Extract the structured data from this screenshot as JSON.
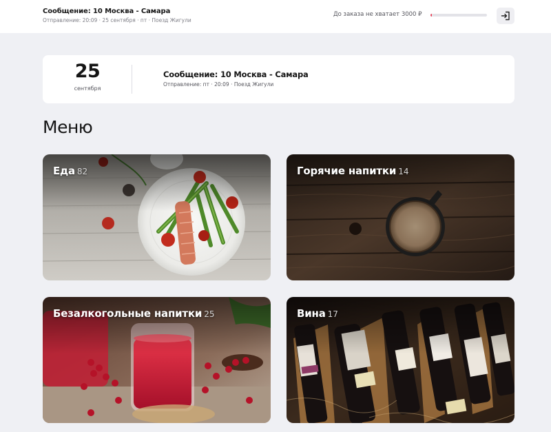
{
  "topbar": {
    "title": "Сообщение: 10 Москва - Самара",
    "subtitle": "Отправление: 20:09 · 25 сентября · пт · Поезд Жигули",
    "progress_label": "До заказа не хватает 3000 ₽",
    "progress_fraction": 0.02,
    "progress_color": "#e84a5f",
    "logout_icon": "logout-icon"
  },
  "trip": {
    "day": "25",
    "month": "сентября",
    "title": "Сообщение: 10 Москва - Самара",
    "subtitle": "Отправление: пт · 20:09 · Поезд Жигули"
  },
  "menu": {
    "heading": "Меню",
    "categories": [
      {
        "name": "Еда",
        "count": "82"
      },
      {
        "name": "Горячие напитки",
        "count": "14"
      },
      {
        "name": "Безалкогольные напитки",
        "count": "25"
      },
      {
        "name": "Вина",
        "count": "17"
      }
    ]
  }
}
